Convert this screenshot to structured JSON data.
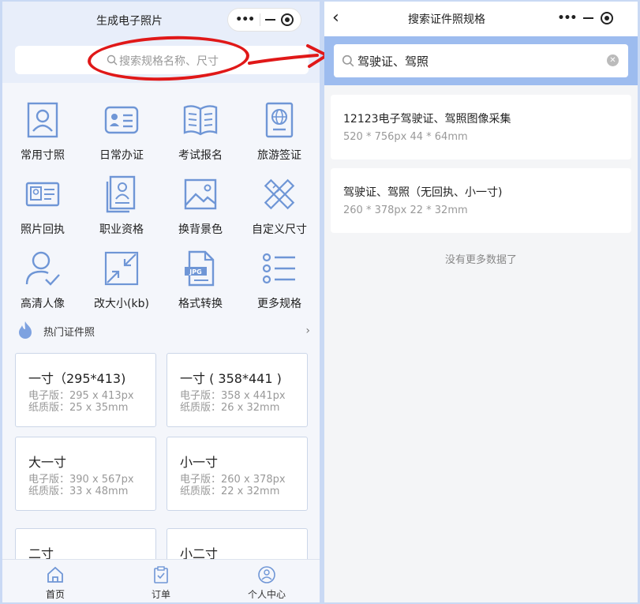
{
  "left": {
    "title": "生成电子照片",
    "search_placeholder": "搜索规格名称、尺寸",
    "categories": [
      {
        "label": "常用寸照",
        "icon": "portrait-icon"
      },
      {
        "label": "日常办证",
        "icon": "id-card-icon"
      },
      {
        "label": "考试报名",
        "icon": "book-icon"
      },
      {
        "label": "旅游签证",
        "icon": "passport-icon"
      },
      {
        "label": "照片回执",
        "icon": "receipt-card-icon"
      },
      {
        "label": "职业资格",
        "icon": "certificate-icon"
      },
      {
        "label": "换背景色",
        "icon": "image-icon"
      },
      {
        "label": "自定义尺寸",
        "icon": "ruler-pencil-icon"
      },
      {
        "label": "高清人像",
        "icon": "person-check-icon"
      },
      {
        "label": "改大小(kb)",
        "icon": "compress-icon"
      },
      {
        "label": "格式转换",
        "icon": "jpg-file-icon"
      },
      {
        "label": "更多规格",
        "icon": "list-icon"
      }
    ],
    "hot_section": {
      "label": "热门证件照",
      "icon": "flame-icon"
    },
    "hot_cards": [
      {
        "title": "一寸（295*413)",
        "digital": "电子版：295 x 413px",
        "paper": "纸质版：25 x 35mm"
      },
      {
        "title": "一寸 ( 358*441 )",
        "digital": "电子版：358 x 441px",
        "paper": "纸质版：26 x 32mm"
      },
      {
        "title": "大一寸",
        "digital": "电子版：390 x 567px",
        "paper": "纸质版：33 x 48mm"
      },
      {
        "title": "小一寸",
        "digital": "电子版：260 x 378px",
        "paper": "纸质版：22 x 32mm"
      },
      {
        "title": "二寸",
        "digital": "",
        "paper": ""
      },
      {
        "title": "小二寸",
        "digital": "",
        "paper": ""
      }
    ],
    "tabs": [
      {
        "label": "首页",
        "icon": "home-icon"
      },
      {
        "label": "订单",
        "icon": "order-clipboard-icon"
      },
      {
        "label": "个人中心",
        "icon": "user-center-icon"
      }
    ]
  },
  "right": {
    "title": "搜索证件照规格",
    "search_value": "驾驶证、驾照",
    "results": [
      {
        "title": "12123电子驾驶证、驾照图像采集",
        "sub": "520 * 756px   44 * 64mm"
      },
      {
        "title": "驾驶证、驾照（无回执、小一寸)",
        "sub": "260 * 378px   22 * 32mm"
      }
    ],
    "no_more": "没有更多数据了"
  },
  "colors": {
    "accent_blue": "#6f96d6",
    "annotation_red": "#e01818",
    "search_band": "#9dbcef"
  }
}
